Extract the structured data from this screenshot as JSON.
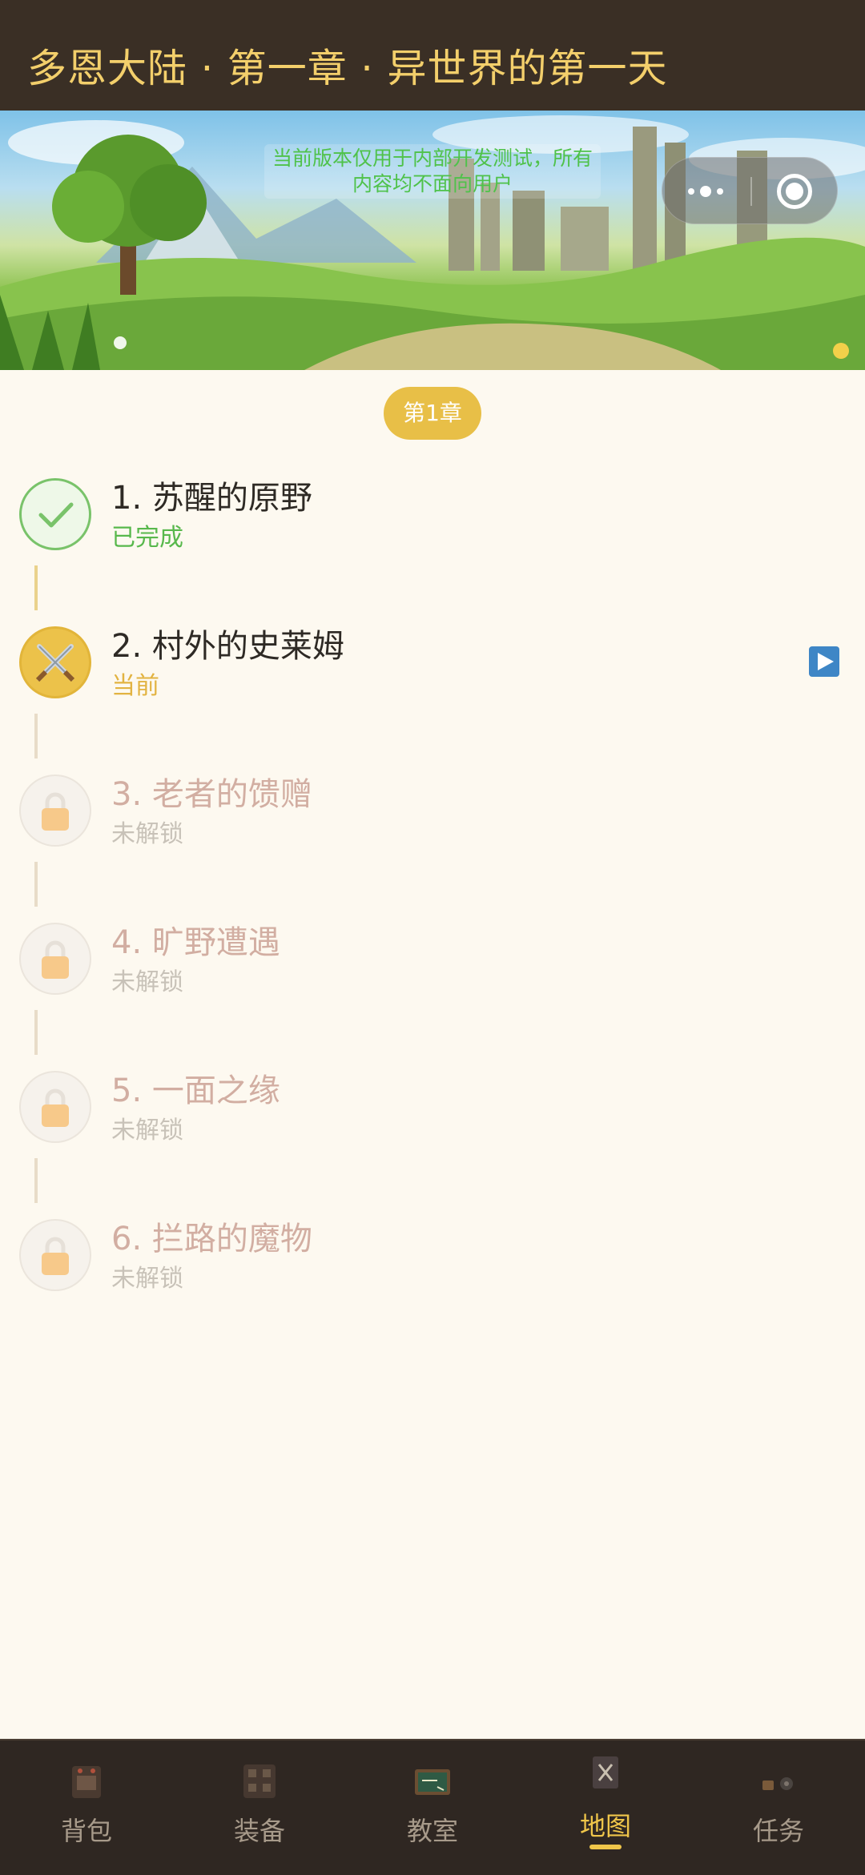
{
  "header": {
    "title": "多恩大陆 · 第一章 · 异世界的第一天"
  },
  "banner": {
    "notice": "当前版本仅用于内部开发测试，所有内容均不面向用户"
  },
  "chapter": {
    "label": "第1章"
  },
  "stages": [
    {
      "title": "1. 苏醒的原野",
      "status": "已完成",
      "state": "done",
      "icon": "check-icon"
    },
    {
      "title": "2. 村外的史莱姆",
      "status": "当前",
      "state": "current",
      "icon": "crossed-swords-icon"
    },
    {
      "title": "3. 老者的馈赠",
      "status": "未解锁",
      "state": "locked",
      "icon": "lock-icon"
    },
    {
      "title": "4. 旷野遭遇",
      "status": "未解锁",
      "state": "locked",
      "icon": "lock-icon"
    },
    {
      "title": "5. 一面之缘",
      "status": "未解锁",
      "state": "locked",
      "icon": "lock-icon"
    },
    {
      "title": "6. 拦路的魔物",
      "status": "未解锁",
      "state": "locked",
      "icon": "lock-icon"
    }
  ],
  "tabs": [
    {
      "label": "背包",
      "icon": "backpack-icon",
      "active": false
    },
    {
      "label": "装备",
      "icon": "equipment-icon",
      "active": false
    },
    {
      "label": "教室",
      "icon": "chalkboard-icon",
      "active": false
    },
    {
      "label": "地图",
      "icon": "map-icon",
      "active": true
    },
    {
      "label": "任务",
      "icon": "quest-icon",
      "active": false
    }
  ],
  "colors": {
    "header_bg": "#3a2f25",
    "header_text": "#f3cf6b",
    "accent": "#e8bf47",
    "done_green": "#58b84c",
    "page_bg": "#fdf9f0",
    "tabbar_bg": "#2f2722"
  }
}
